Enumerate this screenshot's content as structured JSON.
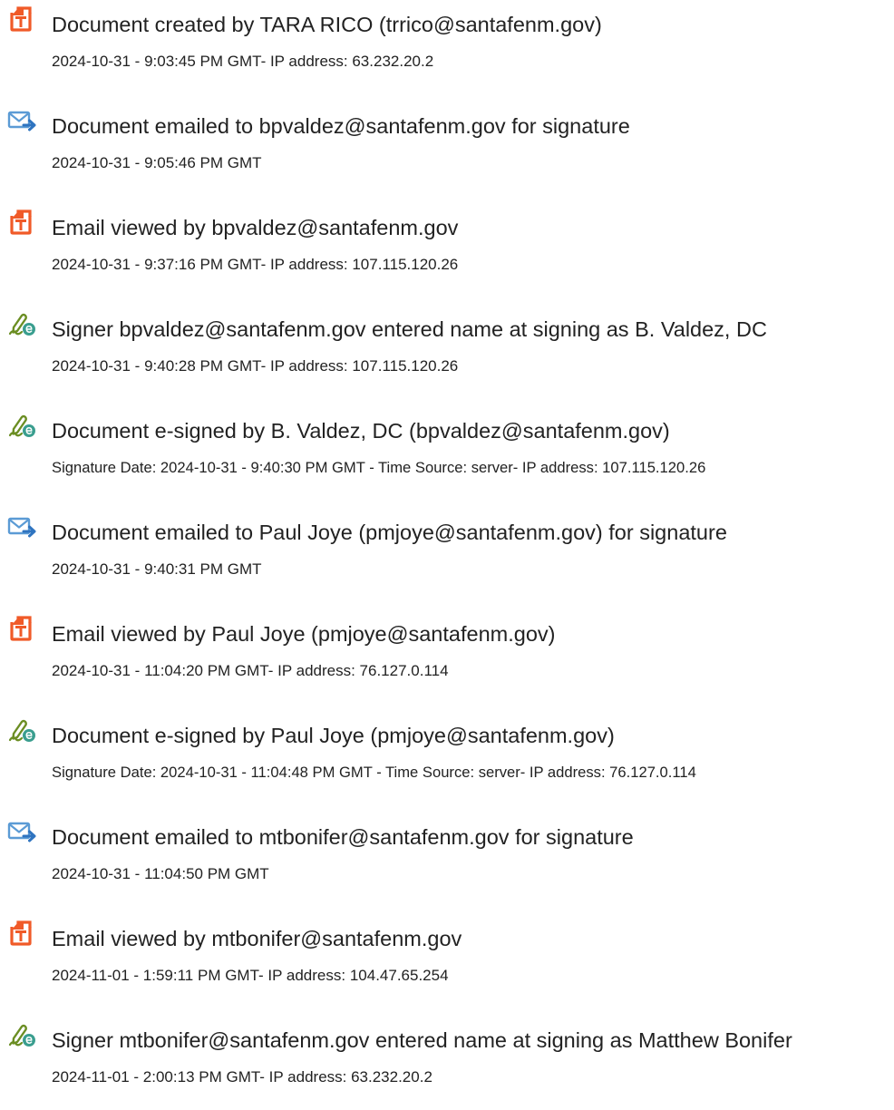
{
  "icons": {
    "document-icon": {
      "color": "#f05a28"
    },
    "email-icon": {
      "color": "#5b9bd5",
      "accent": "#2f74c0"
    },
    "signature-icon": {
      "color": "#6b8e23",
      "accent": "#3a9e8f"
    }
  },
  "events": [
    {
      "icon": "document-icon",
      "title": "Document created by TARA RICO (trrico@santafenm.gov)",
      "detail": "2024-10-31 - 9:03:45 PM GMT- IP address: 63.232.20.2"
    },
    {
      "icon": "email-icon",
      "title": "Document emailed to bpvaldez@santafenm.gov for signature",
      "detail": "2024-10-31 - 9:05:46 PM GMT"
    },
    {
      "icon": "document-icon",
      "title": "Email viewed by bpvaldez@santafenm.gov",
      "detail": "2024-10-31 - 9:37:16 PM GMT- IP address: 107.115.120.26"
    },
    {
      "icon": "signature-icon",
      "title": "Signer bpvaldez@santafenm.gov entered name at signing as B. Valdez, DC",
      "detail": "2024-10-31 - 9:40:28 PM GMT- IP address: 107.115.120.26"
    },
    {
      "icon": "signature-icon",
      "title": "Document e-signed by B. Valdez, DC (bpvaldez@santafenm.gov)",
      "detail": "Signature Date: 2024-10-31 - 9:40:30 PM GMT - Time Source: server- IP address: 107.115.120.26"
    },
    {
      "icon": "email-icon",
      "title": "Document emailed to Paul Joye (pmjoye@santafenm.gov) for signature",
      "detail": "2024-10-31 - 9:40:31 PM GMT"
    },
    {
      "icon": "document-icon",
      "title": "Email viewed by Paul Joye (pmjoye@santafenm.gov)",
      "detail": "2024-10-31 - 11:04:20 PM GMT- IP address: 76.127.0.114"
    },
    {
      "icon": "signature-icon",
      "title": "Document e-signed by Paul Joye (pmjoye@santafenm.gov)",
      "detail": "Signature Date: 2024-10-31 - 11:04:48 PM GMT - Time Source: server- IP address: 76.127.0.114"
    },
    {
      "icon": "email-icon",
      "title": "Document emailed to mtbonifer@santafenm.gov for signature",
      "detail": "2024-10-31 - 11:04:50 PM GMT"
    },
    {
      "icon": "document-icon",
      "title": "Email viewed by mtbonifer@santafenm.gov",
      "detail": "2024-11-01 - 1:59:11 PM GMT- IP address: 104.47.65.254"
    },
    {
      "icon": "signature-icon",
      "title": "Signer mtbonifer@santafenm.gov entered name at signing as Matthew Bonifer",
      "detail": "2024-11-01 - 2:00:13 PM GMT- IP address: 63.232.20.2"
    }
  ]
}
